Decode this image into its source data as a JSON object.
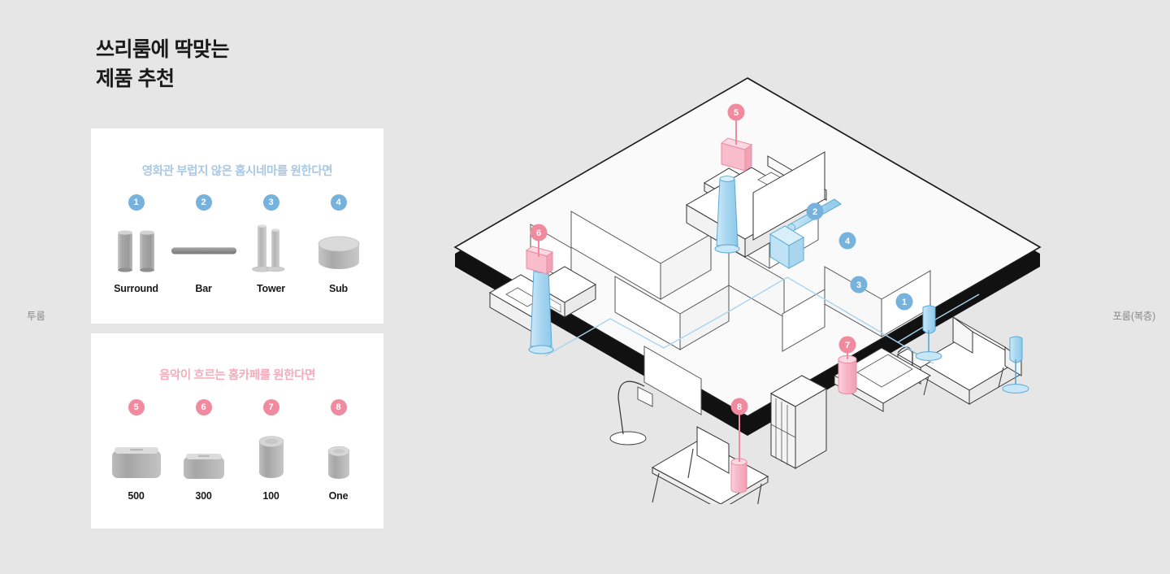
{
  "page": {
    "background_color": "#e6e6e6",
    "title": "쓰리룸에 딱맞는\n제품 추천"
  },
  "side_labels": {
    "left": "투룸",
    "right": "포룸(복층)"
  },
  "colors": {
    "accent_blue": "#76b2dc",
    "accent_pink": "#f08a9e",
    "title_blue": "#a9c8e4",
    "title_pink": "#f4acba",
    "card_background": "#ffffff",
    "text": "#1a1a1a",
    "side_label": "#8a8a8a"
  },
  "cards": [
    {
      "id": "cinema",
      "title": "영화관 부럽지 않은 홈시네마를 원한다면",
      "accent": "blue",
      "items": [
        {
          "number": "1",
          "label": "Surround",
          "icon": "surround-speaker-pair-icon"
        },
        {
          "number": "2",
          "label": "Bar",
          "icon": "soundbar-icon"
        },
        {
          "number": "3",
          "label": "Tower",
          "icon": "tower-speaker-pair-icon"
        },
        {
          "number": "4",
          "label": "Sub",
          "icon": "subwoofer-icon"
        }
      ]
    },
    {
      "id": "cafe",
      "title": "음악이 흐르는 홈카페를 원한다면",
      "accent": "pink",
      "items": [
        {
          "number": "5",
          "label": "500",
          "icon": "wide-speaker-large-icon"
        },
        {
          "number": "6",
          "label": "300",
          "icon": "wide-speaker-small-icon"
        },
        {
          "number": "7",
          "label": "100",
          "icon": "cylinder-speaker-tall-icon"
        },
        {
          "number": "8",
          "label": "One",
          "icon": "cylinder-speaker-small-icon"
        }
      ]
    }
  ],
  "floorplan": {
    "name": "isometric-three-room-floorplan",
    "markers": [
      {
        "number": "1",
        "accent": "blue",
        "placement": "living-room-surround-speakers"
      },
      {
        "number": "2",
        "accent": "blue",
        "placement": "living-room-soundbar-under-tv"
      },
      {
        "number": "3",
        "accent": "blue",
        "placement": "living-room-tower-speakers"
      },
      {
        "number": "4",
        "accent": "blue",
        "placement": "living-room-subwoofer"
      },
      {
        "number": "5",
        "accent": "pink",
        "placement": "bedroom-nightstand-speaker"
      },
      {
        "number": "6",
        "accent": "pink",
        "placement": "bathroom-vanity-speaker"
      },
      {
        "number": "7",
        "accent": "pink",
        "placement": "kitchen-counter-speaker"
      },
      {
        "number": "8",
        "accent": "pink",
        "placement": "dining-table-speaker"
      }
    ]
  }
}
